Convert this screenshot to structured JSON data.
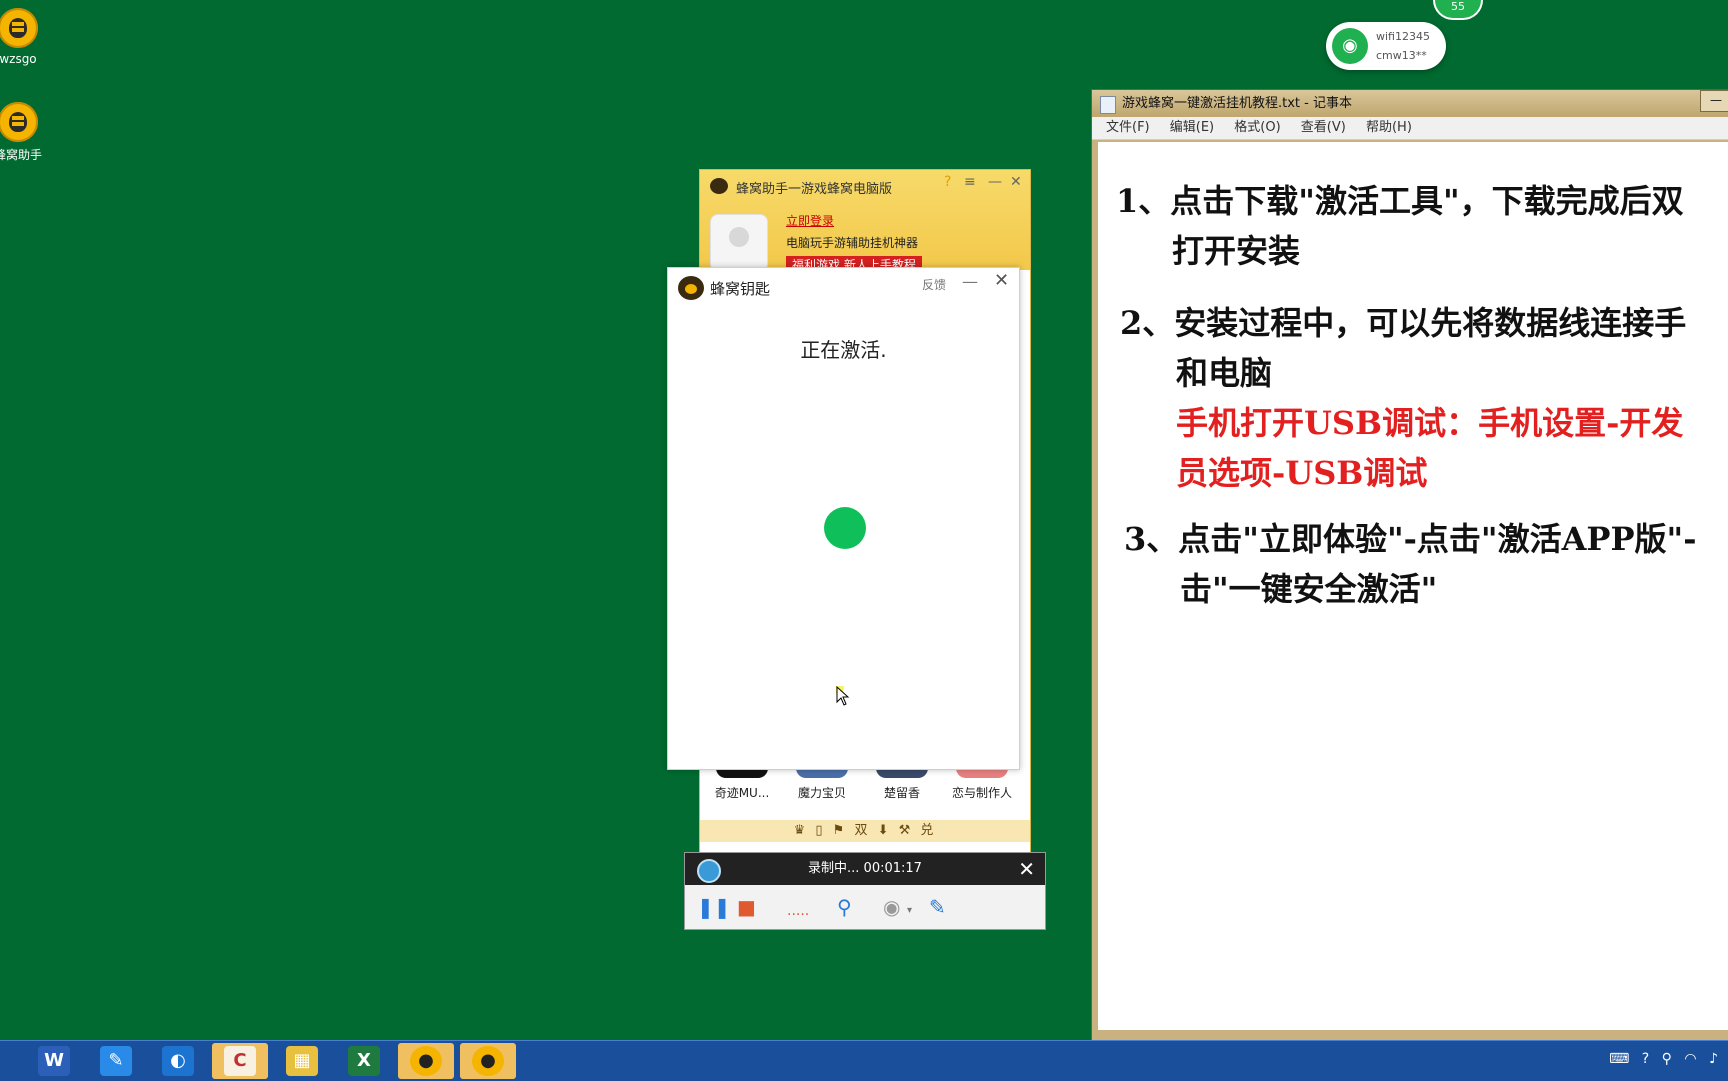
{
  "desktop": {
    "icons": [
      {
        "label": "wzsgo"
      },
      {
        "label": "蜂窝助手"
      }
    ]
  },
  "wifi": {
    "ssid": "wifi12345",
    "password": "cmw13**"
  },
  "badge": "55",
  "notepad": {
    "title": "游戏蜂窝一键激活挂机教程.txt - 记事本",
    "menu": [
      "文件(F)",
      "编辑(E)",
      "格式(O)",
      "查看(V)",
      "帮助(H)"
    ],
    "lines": [
      "1、点击下载\"激活工具\"，下载完成后双",
      "打开安装",
      "2、安装过程中，可以先将数据线连接手",
      "和电脑",
      "手机打开USB调试：手机设置-开发",
      "员选项-USB调试",
      "3、点击\"立即体验\"-点击\"激活APP版\"-",
      "击\"一键安全激活\""
    ]
  },
  "beehive": {
    "title": "蜂窝助手一游戏蜂窝电脑版",
    "login": "立即登录",
    "slogan": "电脑玩手游辅助挂机神器",
    "promo": "福利游戏 新人上手教程",
    "games": [
      "奇迹MU...",
      "魔力宝贝",
      "楚留香",
      "恋与制作人"
    ],
    "tools": "♛ ▯ ⚑ 双 ⬇ ⚒ 兑"
  },
  "key_popup": {
    "title": "蜂窝钥匙",
    "feedback": "反馈",
    "status": "正在激活."
  },
  "recorder": {
    "status": "录制中... 00:01:17"
  },
  "taskbar": {
    "apps": [
      "word-app",
      "notes-app",
      "browser-app",
      "game-app",
      "explorer-app",
      "excel-app",
      "beehive-app",
      "beehive-key-app"
    ]
  },
  "colors": {
    "desktop": "#006a30",
    "activate_dot": "#0fc05a",
    "red_text": "#e32020"
  }
}
